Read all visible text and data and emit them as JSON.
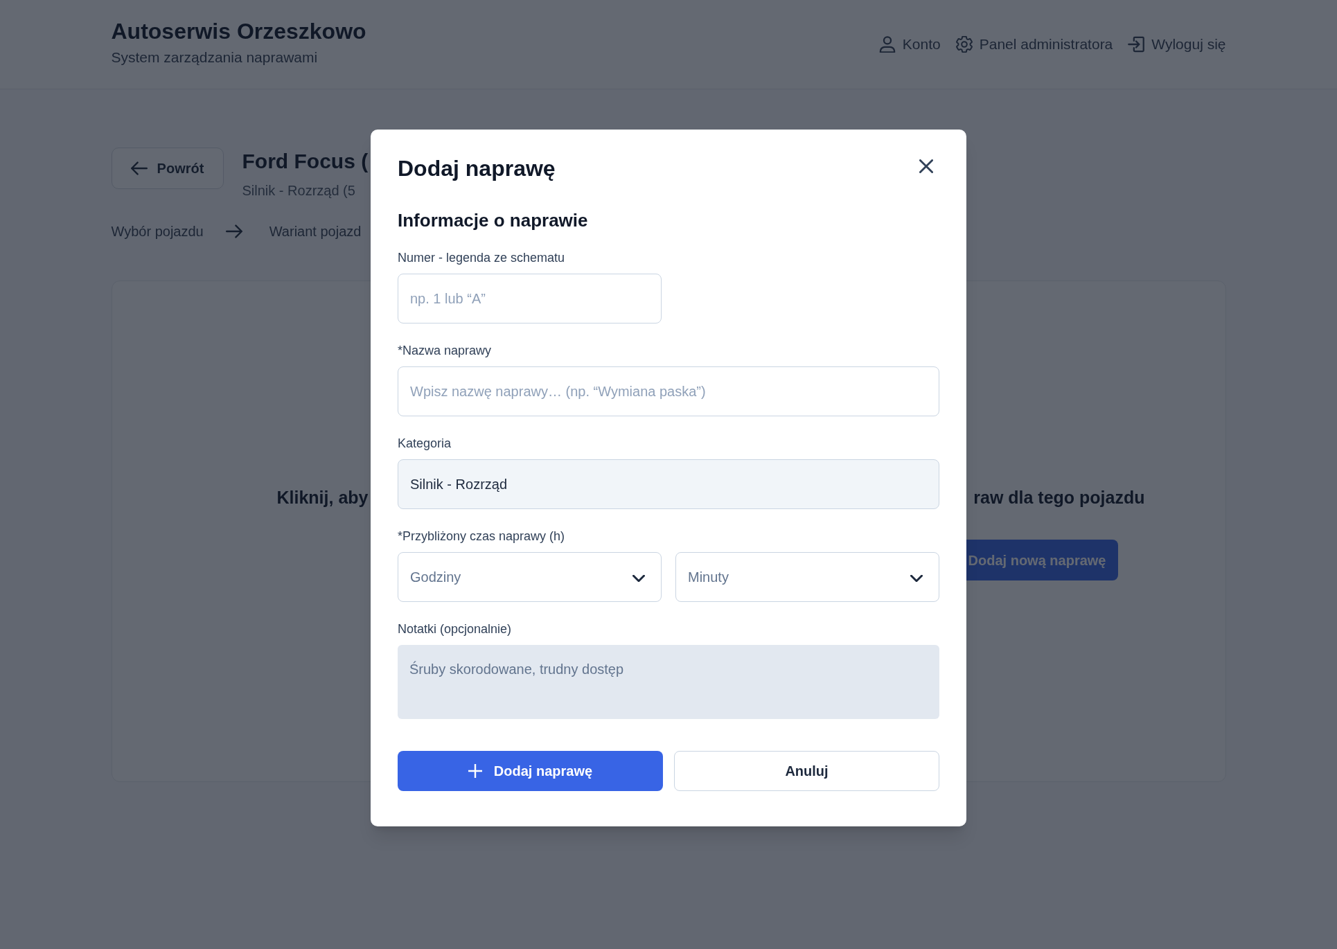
{
  "header": {
    "title": "Autoserwis Orzeszkowo",
    "subtitle": "System zarządzania naprawami",
    "nav": [
      {
        "kind": "user",
        "label": "Konto"
      },
      {
        "kind": "gear",
        "label": "Panel administratora"
      },
      {
        "kind": "logout",
        "label": "Wyloguj się"
      }
    ]
  },
  "page": {
    "back_button": "Powrót",
    "title": "Ford Focus (",
    "subtitle": "Silnik - Rozrząd (5",
    "breadcrumb": [
      "Wybór pojazdu",
      "Wariant pojazd"
    ]
  },
  "empty_state": {
    "text_left": "Kliknij, aby",
    "text_right": "raw dla tego pojazdu",
    "button": "Dodaj nową naprawę"
  },
  "modal": {
    "title": "Dodaj naprawę",
    "section_title": "Informacje o naprawie",
    "fields": [
      {
        "kind": "short_text",
        "label": "Numer - legenda ze schematu",
        "placeholder": "np. 1 lub “A”"
      },
      {
        "kind": "text",
        "label": "*Nazwa naprawy",
        "placeholder": "Wpisz nazwę naprawy… (np. “Wymiana paska”)"
      },
      {
        "kind": "readonly",
        "label": "Kategoria",
        "value": "Silnik - Rozrząd"
      },
      {
        "kind": "select_pair",
        "label": "*Przybliżony czas naprawy (h)",
        "selects": [
          {
            "placeholder": "Godziny"
          },
          {
            "placeholder": "Minuty"
          }
        ]
      },
      {
        "kind": "textarea",
        "label": "Notatki (opcjonalnie)",
        "placeholder": "Śruby skorodowane, trudny dostęp"
      }
    ],
    "buttons": [
      {
        "kind": "primary",
        "label": "Dodaj naprawę"
      },
      {
        "kind": "secondary",
        "label": "Anuluj"
      }
    ]
  }
}
